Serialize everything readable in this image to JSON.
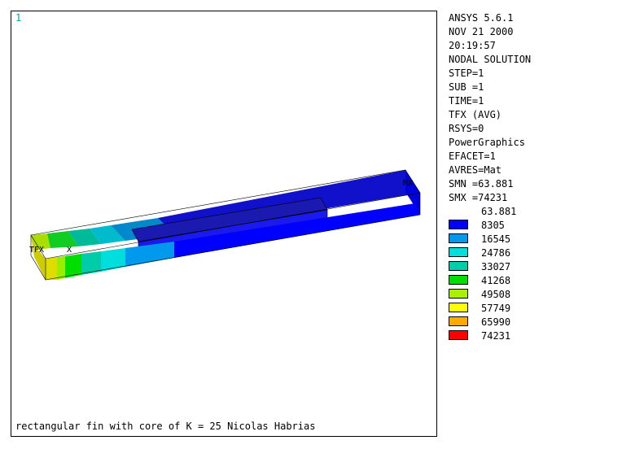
{
  "viewport": {
    "window_number": "1",
    "caption": "rectangular fin with core of K = 25 Nicolas Habrias",
    "labels": {
      "tfx": "TFX",
      "x": "X",
      "mx": "MX"
    }
  },
  "info": {
    "lines": [
      "ANSYS 5.6.1",
      "NOV 21 2000",
      "20:19:57",
      "NODAL SOLUTION",
      "STEP=1",
      "SUB =1",
      "TIME=1",
      "TFX      (AVG)",
      "RSYS=0",
      "PowerGraphics",
      "EFACET=1",
      "AVRES=Mat",
      "SMN =63.881",
      "SMX =74231"
    ],
    "legend_min": "63.881",
    "legend": [
      {
        "label": "8305",
        "color": "#0000ff"
      },
      {
        "label": "16545",
        "color": "#0099ee"
      },
      {
        "label": "24786",
        "color": "#00dddd"
      },
      {
        "label": "33027",
        "color": "#00ccaa"
      },
      {
        "label": "41268",
        "color": "#00dd00"
      },
      {
        "label": "49508",
        "color": "#aaee00"
      },
      {
        "label": "57749",
        "color": "#ffff00"
      },
      {
        "label": "65990",
        "color": "#ffaa00"
      },
      {
        "label": "74231",
        "color": "#ff0000"
      }
    ]
  }
}
